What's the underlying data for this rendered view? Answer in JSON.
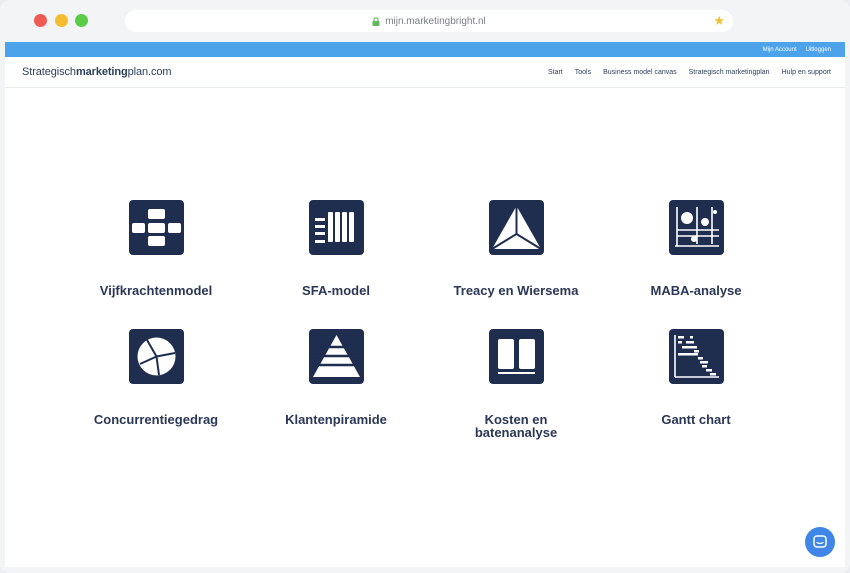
{
  "browser": {
    "url": "mijn.marketingbright.nl"
  },
  "topbar": {
    "account": "Mijn Account",
    "logout": "Uitloggen"
  },
  "brand": {
    "prefix": "Strategisch",
    "bold": "marketing",
    "suffix": "plan.com"
  },
  "nav": [
    "Start",
    "Tools",
    "Business model canvas",
    "Strategisch marketingplan",
    "Hulp en support"
  ],
  "tools": [
    {
      "label": "Vijfkrachtenmodel",
      "icon": "five-forces-icon"
    },
    {
      "label": "SFA-model",
      "icon": "sfa-icon"
    },
    {
      "label": "Treacy en Wiersema",
      "icon": "triangle-icon"
    },
    {
      "label": "MABA-analyse",
      "icon": "matrix-icon"
    },
    {
      "label": "Concurrentiegedrag",
      "icon": "pie-icon"
    },
    {
      "label": "Klantenpiramide",
      "icon": "pyramid-icon"
    },
    {
      "label": "Kosten en batenanalyse",
      "icon": "book-icon"
    },
    {
      "label": "Gantt chart",
      "icon": "gantt-icon"
    }
  ],
  "colors": {
    "accent": "#4da3ea",
    "icon_bg": "#1f2d4f",
    "text": "#2b3756",
    "chat": "#3f86e6"
  }
}
